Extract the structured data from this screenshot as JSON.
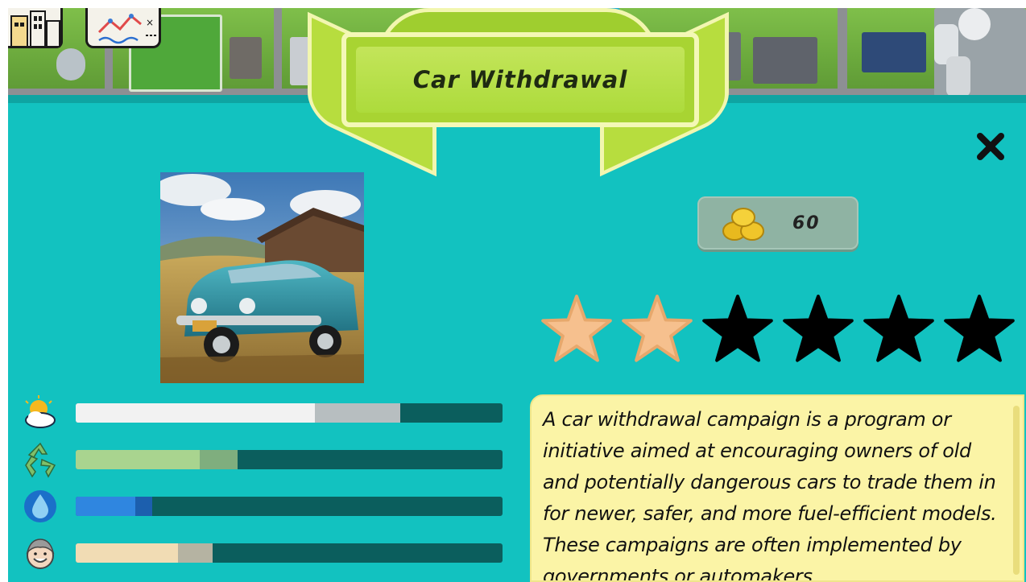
{
  "header": {
    "title": "Car Withdrawal"
  },
  "icons": {
    "buildings": "buildings-icon",
    "chart": "chart-icon",
    "close": "close-icon",
    "coins": "coins-icon"
  },
  "reward": {
    "coins": "60"
  },
  "rating": {
    "filled": 2,
    "total": 6,
    "filled_color": "#f6c08e",
    "empty_color": "#000000"
  },
  "stats": [
    {
      "name": "weather",
      "icon": "weather-icon",
      "value": 0.56,
      "preview": 0.76,
      "color": "#f2f2f2",
      "ghost": "#b7bec0"
    },
    {
      "name": "recycling",
      "icon": "recycle-icon",
      "value": 0.29,
      "preview": 0.38,
      "color": "#a9d48f",
      "ghost": "#7fae7e"
    },
    {
      "name": "water",
      "icon": "water-drop-icon",
      "value": 0.14,
      "preview": 0.18,
      "color": "#2f86e0",
      "ghost": "#1c5fae"
    },
    {
      "name": "happiness",
      "icon": "citizen-face-icon",
      "value": 0.24,
      "preview": 0.32,
      "color": "#f1dcb4",
      "ghost": "#b5b3a2"
    }
  ],
  "description": "A car withdrawal campaign is a program or initiative aimed at encouraging owners of old and potentially dangerous cars to trade them in for newer, safer, and more fuel-efficient models. These campaigns are often implemented by governments or automakers"
}
